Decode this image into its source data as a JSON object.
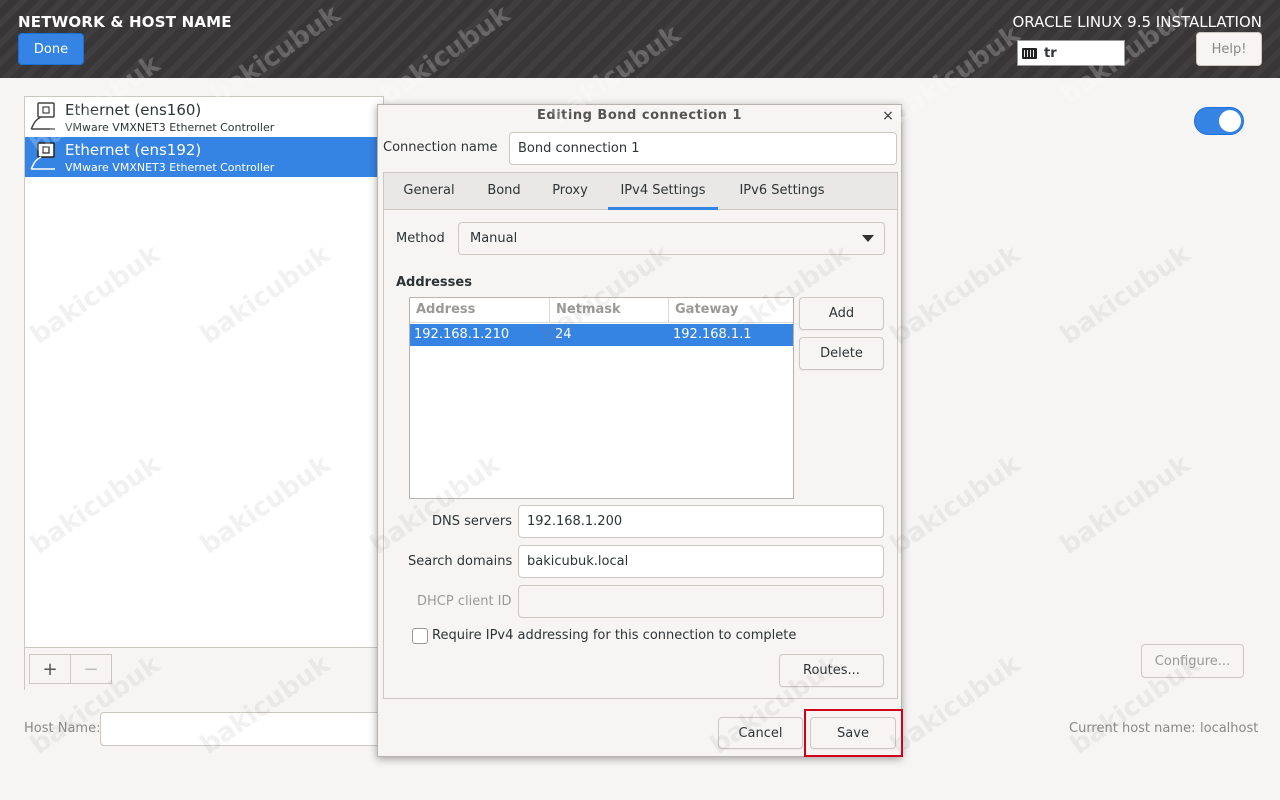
{
  "header": {
    "spoke_title": "NETWORK & HOST NAME",
    "done_label": "Done",
    "product_title": "ORACLE LINUX 9.5 INSTALLATION",
    "keyboard_layout": "tr",
    "help_label": "Help!"
  },
  "devices": [
    {
      "name": "Ethernet (ens160)",
      "description": "VMware VMXNET3 Ethernet Controller",
      "selected": false
    },
    {
      "name": "Ethernet (ens192)",
      "description": "VMware VMXNET3 Ethernet Controller",
      "selected": true
    }
  ],
  "list_toolbar": {
    "add_label": "+",
    "remove_label": "−"
  },
  "configure_label": "Configure...",
  "hostname": {
    "label": "Host Name:",
    "value": "",
    "current_label": "Current host name:",
    "current_value": "localhost"
  },
  "dialog": {
    "title": "Editing Bond connection 1",
    "close_glyph": "×",
    "connection_name_label": "Connection name",
    "connection_name_value": "Bond connection 1",
    "tabs": [
      {
        "label": "General"
      },
      {
        "label": "Bond"
      },
      {
        "label": "Proxy"
      },
      {
        "label": "IPv4 Settings",
        "active": true
      },
      {
        "label": "IPv6 Settings"
      }
    ],
    "method_label": "Method",
    "method_value": "Manual",
    "addresses_label": "Addresses",
    "table_headers": [
      "Address",
      "Netmask",
      "Gateway"
    ],
    "addresses": [
      {
        "address": "192.168.1.210",
        "netmask": "24",
        "gateway": "192.168.1.1"
      }
    ],
    "add_label": "Add",
    "delete_label": "Delete",
    "dns_label": "DNS servers",
    "dns_value": "192.168.1.200",
    "search_label": "Search domains",
    "search_value": "bakicubuk.local",
    "dhcp_label": "DHCP client ID",
    "dhcp_value": "",
    "require_label": "Require IPv4 addressing for this connection to complete",
    "require_checked": false,
    "routes_label": "Routes...",
    "cancel_label": "Cancel",
    "save_label": "Save"
  },
  "watermark_text": "bakicubuk",
  "colors": {
    "accent": "#3584e4",
    "header_bg": "#3a3838",
    "highlight_box": "#d0021b"
  }
}
